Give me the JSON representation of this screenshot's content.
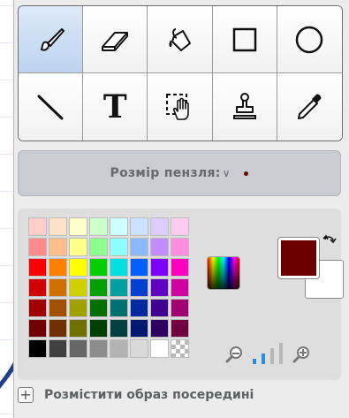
{
  "tools": [
    {
      "name": "brush-tool",
      "icon": "brush-icon",
      "selected": true
    },
    {
      "name": "eraser-tool",
      "icon": "eraser-icon",
      "selected": false
    },
    {
      "name": "fill-tool",
      "icon": "paint-bucket-icon",
      "selected": false
    },
    {
      "name": "rectangle-tool",
      "icon": "rectangle-icon",
      "selected": false
    },
    {
      "name": "ellipse-tool",
      "icon": "ellipse-icon",
      "selected": false
    },
    {
      "name": "line-tool",
      "icon": "line-icon",
      "selected": false
    },
    {
      "name": "text-tool",
      "icon": "text-icon",
      "glyph": "T",
      "selected": false
    },
    {
      "name": "select-tool",
      "icon": "select-hand-icon",
      "selected": false
    },
    {
      "name": "stamp-tool",
      "icon": "stamp-icon",
      "selected": false
    },
    {
      "name": "eyedropper-tool",
      "icon": "eyedropper-icon",
      "selected": false
    }
  ],
  "brush": {
    "label": "Розмір пензля:",
    "chevron": "∨",
    "dot_color": "#6a0000"
  },
  "palette": {
    "colors": [
      "#ffcccc",
      "#ffe0c8",
      "#ffffcc",
      "#ccffcc",
      "#ccffff",
      "#cce0ff",
      "#ddccff",
      "#ffccf0",
      "#ff8c8c",
      "#ffbf8c",
      "#ffff8c",
      "#8cff8c",
      "#8cffff",
      "#8cb8ff",
      "#c08cff",
      "#ff8ce0",
      "#ff0000",
      "#ff8000",
      "#ffff00",
      "#00d000",
      "#00e0e0",
      "#0060ff",
      "#8000ff",
      "#ff00c0",
      "#d00000",
      "#d07000",
      "#d0d000",
      "#00a000",
      "#00a0a0",
      "#0040d0",
      "#6000c0",
      "#d000a0",
      "#a00000",
      "#a05000",
      "#a0a000",
      "#007000",
      "#007070",
      "#002aa0",
      "#400090",
      "#a00070",
      "#700000",
      "#703000",
      "#707000",
      "#004000",
      "#004040",
      "#001870",
      "#300060",
      "#700040",
      "#000000",
      "#404040",
      "#666666",
      "#8c8c8c",
      "#b3b3b3",
      "#d9d9d9",
      "#ffffff",
      "checker"
    ]
  },
  "colors": {
    "primary": "#6a0000",
    "secondary": "#ffffff"
  },
  "zoom": {
    "out_icon": "zoom-out-icon",
    "in_icon": "zoom-in-icon",
    "level": 2,
    "levels": 4,
    "active_color": "#2a8de0"
  },
  "center": {
    "label": "Розмістити образ посередині",
    "button": "+"
  }
}
